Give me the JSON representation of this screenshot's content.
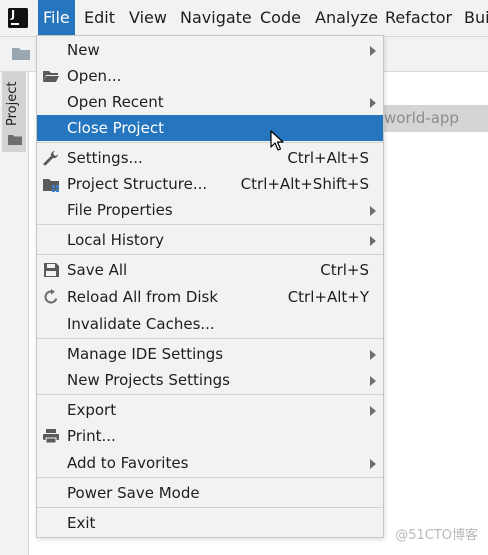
{
  "menubar": {
    "items": [
      {
        "label": "File",
        "active": true
      },
      {
        "label": "Edit"
      },
      {
        "label": "View"
      },
      {
        "label": "Navigate"
      },
      {
        "label": "Code"
      },
      {
        "label": "Analyze"
      },
      {
        "label": "Refactor"
      },
      {
        "label": "Bui"
      }
    ]
  },
  "side_panel": {
    "tab_label": "Project"
  },
  "background": {
    "project_name": "world-app"
  },
  "file_menu": {
    "items": [
      {
        "label": "New",
        "submenu": true
      },
      {
        "label": "Open...",
        "icon": "folder-open-icon"
      },
      {
        "label": "Open Recent",
        "submenu": true
      },
      {
        "label": "Close Project",
        "highlighted": true
      },
      {
        "label": "Settings...",
        "icon": "wrench-icon",
        "shortcut": "Ctrl+Alt+S"
      },
      {
        "label": "Project Structure...",
        "icon": "project-structure-icon",
        "shortcut": "Ctrl+Alt+Shift+S"
      },
      {
        "label": "File Properties",
        "submenu": true
      },
      {
        "label": "Local History",
        "submenu": true
      },
      {
        "label": "Save All",
        "icon": "save-icon",
        "shortcut": "Ctrl+S"
      },
      {
        "label": "Reload All from Disk",
        "icon": "reload-icon",
        "shortcut": "Ctrl+Alt+Y"
      },
      {
        "label": "Invalidate Caches..."
      },
      {
        "label": "Manage IDE Settings",
        "submenu": true
      },
      {
        "label": "New Projects Settings",
        "submenu": true
      },
      {
        "label": "Export",
        "submenu": true
      },
      {
        "label": "Print...",
        "icon": "printer-icon"
      },
      {
        "label": "Add to Favorites",
        "submenu": true
      },
      {
        "label": "Power Save Mode"
      },
      {
        "label": "Exit"
      }
    ]
  },
  "watermark": "@51CTO博客",
  "colors": {
    "accent": "#2675bf",
    "menu_bg": "#f2f2f2"
  }
}
